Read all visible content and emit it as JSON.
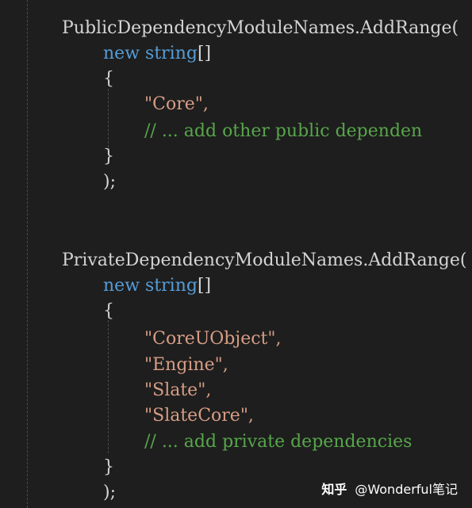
{
  "code": {
    "public_block": {
      "call": "PublicDependencyModuleNames.AddRange(",
      "new_kw": "new",
      "type_kw": "string",
      "brackets": "[]",
      "open_brace": "{",
      "items": [
        "\"Core\","
      ],
      "comment": "// ... add other public dependen",
      "close_brace": "}",
      "close_paren": ");"
    },
    "private_block": {
      "call": "PrivateDependencyModuleNames.AddRange(",
      "new_kw": "new",
      "type_kw": "string",
      "brackets": "[]",
      "open_brace": "{",
      "items": [
        "\"CoreUObject\",",
        "\"Engine\",",
        "\"Slate\",",
        "\"SlateCore\","
      ],
      "comment": "// ... add private dependencies",
      "close_brace": "}",
      "close_paren": ");"
    }
  },
  "colors": {
    "background": "#1e1e1e",
    "keyword": "#569cd6",
    "string": "#d69d85",
    "comment": "#57a64a",
    "plain": "#d4d4d4"
  },
  "watermark": {
    "logo": "知乎",
    "handle": "@Wonderful笔记"
  }
}
